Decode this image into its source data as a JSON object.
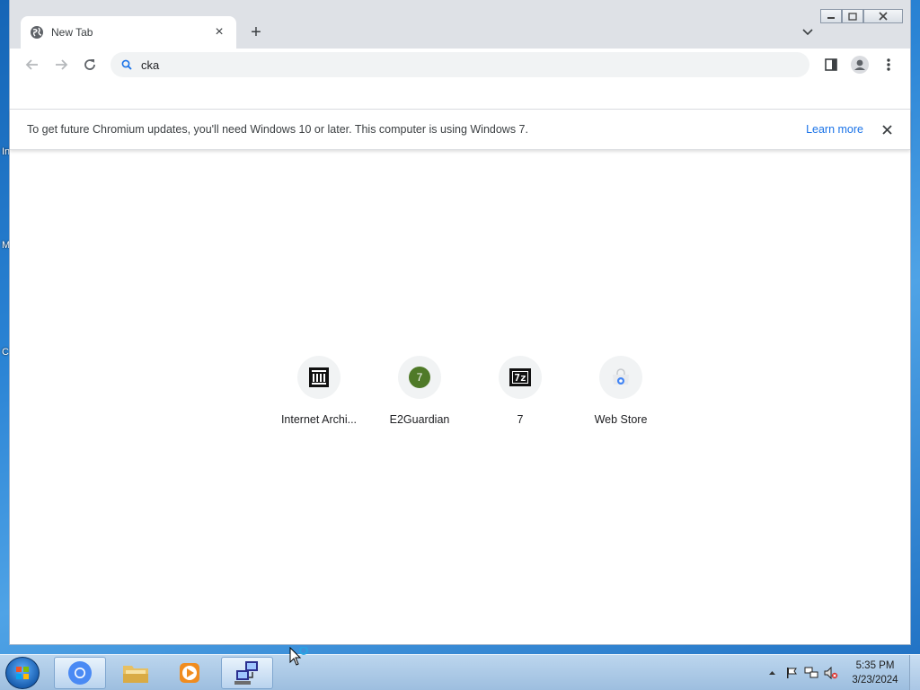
{
  "desktop": {
    "fragments": [
      "In",
      "M",
      "C"
    ]
  },
  "browser": {
    "tab": {
      "title": "New Tab",
      "close": "×"
    },
    "new_tab": "+",
    "omnibox": {
      "value": "cka",
      "placeholder": ""
    },
    "infobar": {
      "message": "To get future Chromium updates, you'll need Windows 10 or later. This computer is using Windows 7.",
      "link": "Learn more"
    },
    "shortcuts": [
      {
        "label": "Internet Archi...",
        "icon": "internet-archive-icon"
      },
      {
        "label": "E2Guardian",
        "icon": "e2guardian-icon",
        "badge": "7",
        "color": "#4f7a28"
      },
      {
        "label": "7",
        "icon": "7zip-icon",
        "glyph": "7z"
      },
      {
        "label": "Web Store",
        "icon": "web-store-icon"
      }
    ]
  },
  "taskbar": {
    "clock": {
      "time": "5:35 PM",
      "date": "3/23/2024"
    },
    "apps": [
      "chromium",
      "file-explorer",
      "media-player",
      "network-app"
    ]
  },
  "colors": {
    "accent": "#1a73e8",
    "tabstrip": "#dee1e6",
    "omnibox_bg": "#f1f3f4"
  }
}
